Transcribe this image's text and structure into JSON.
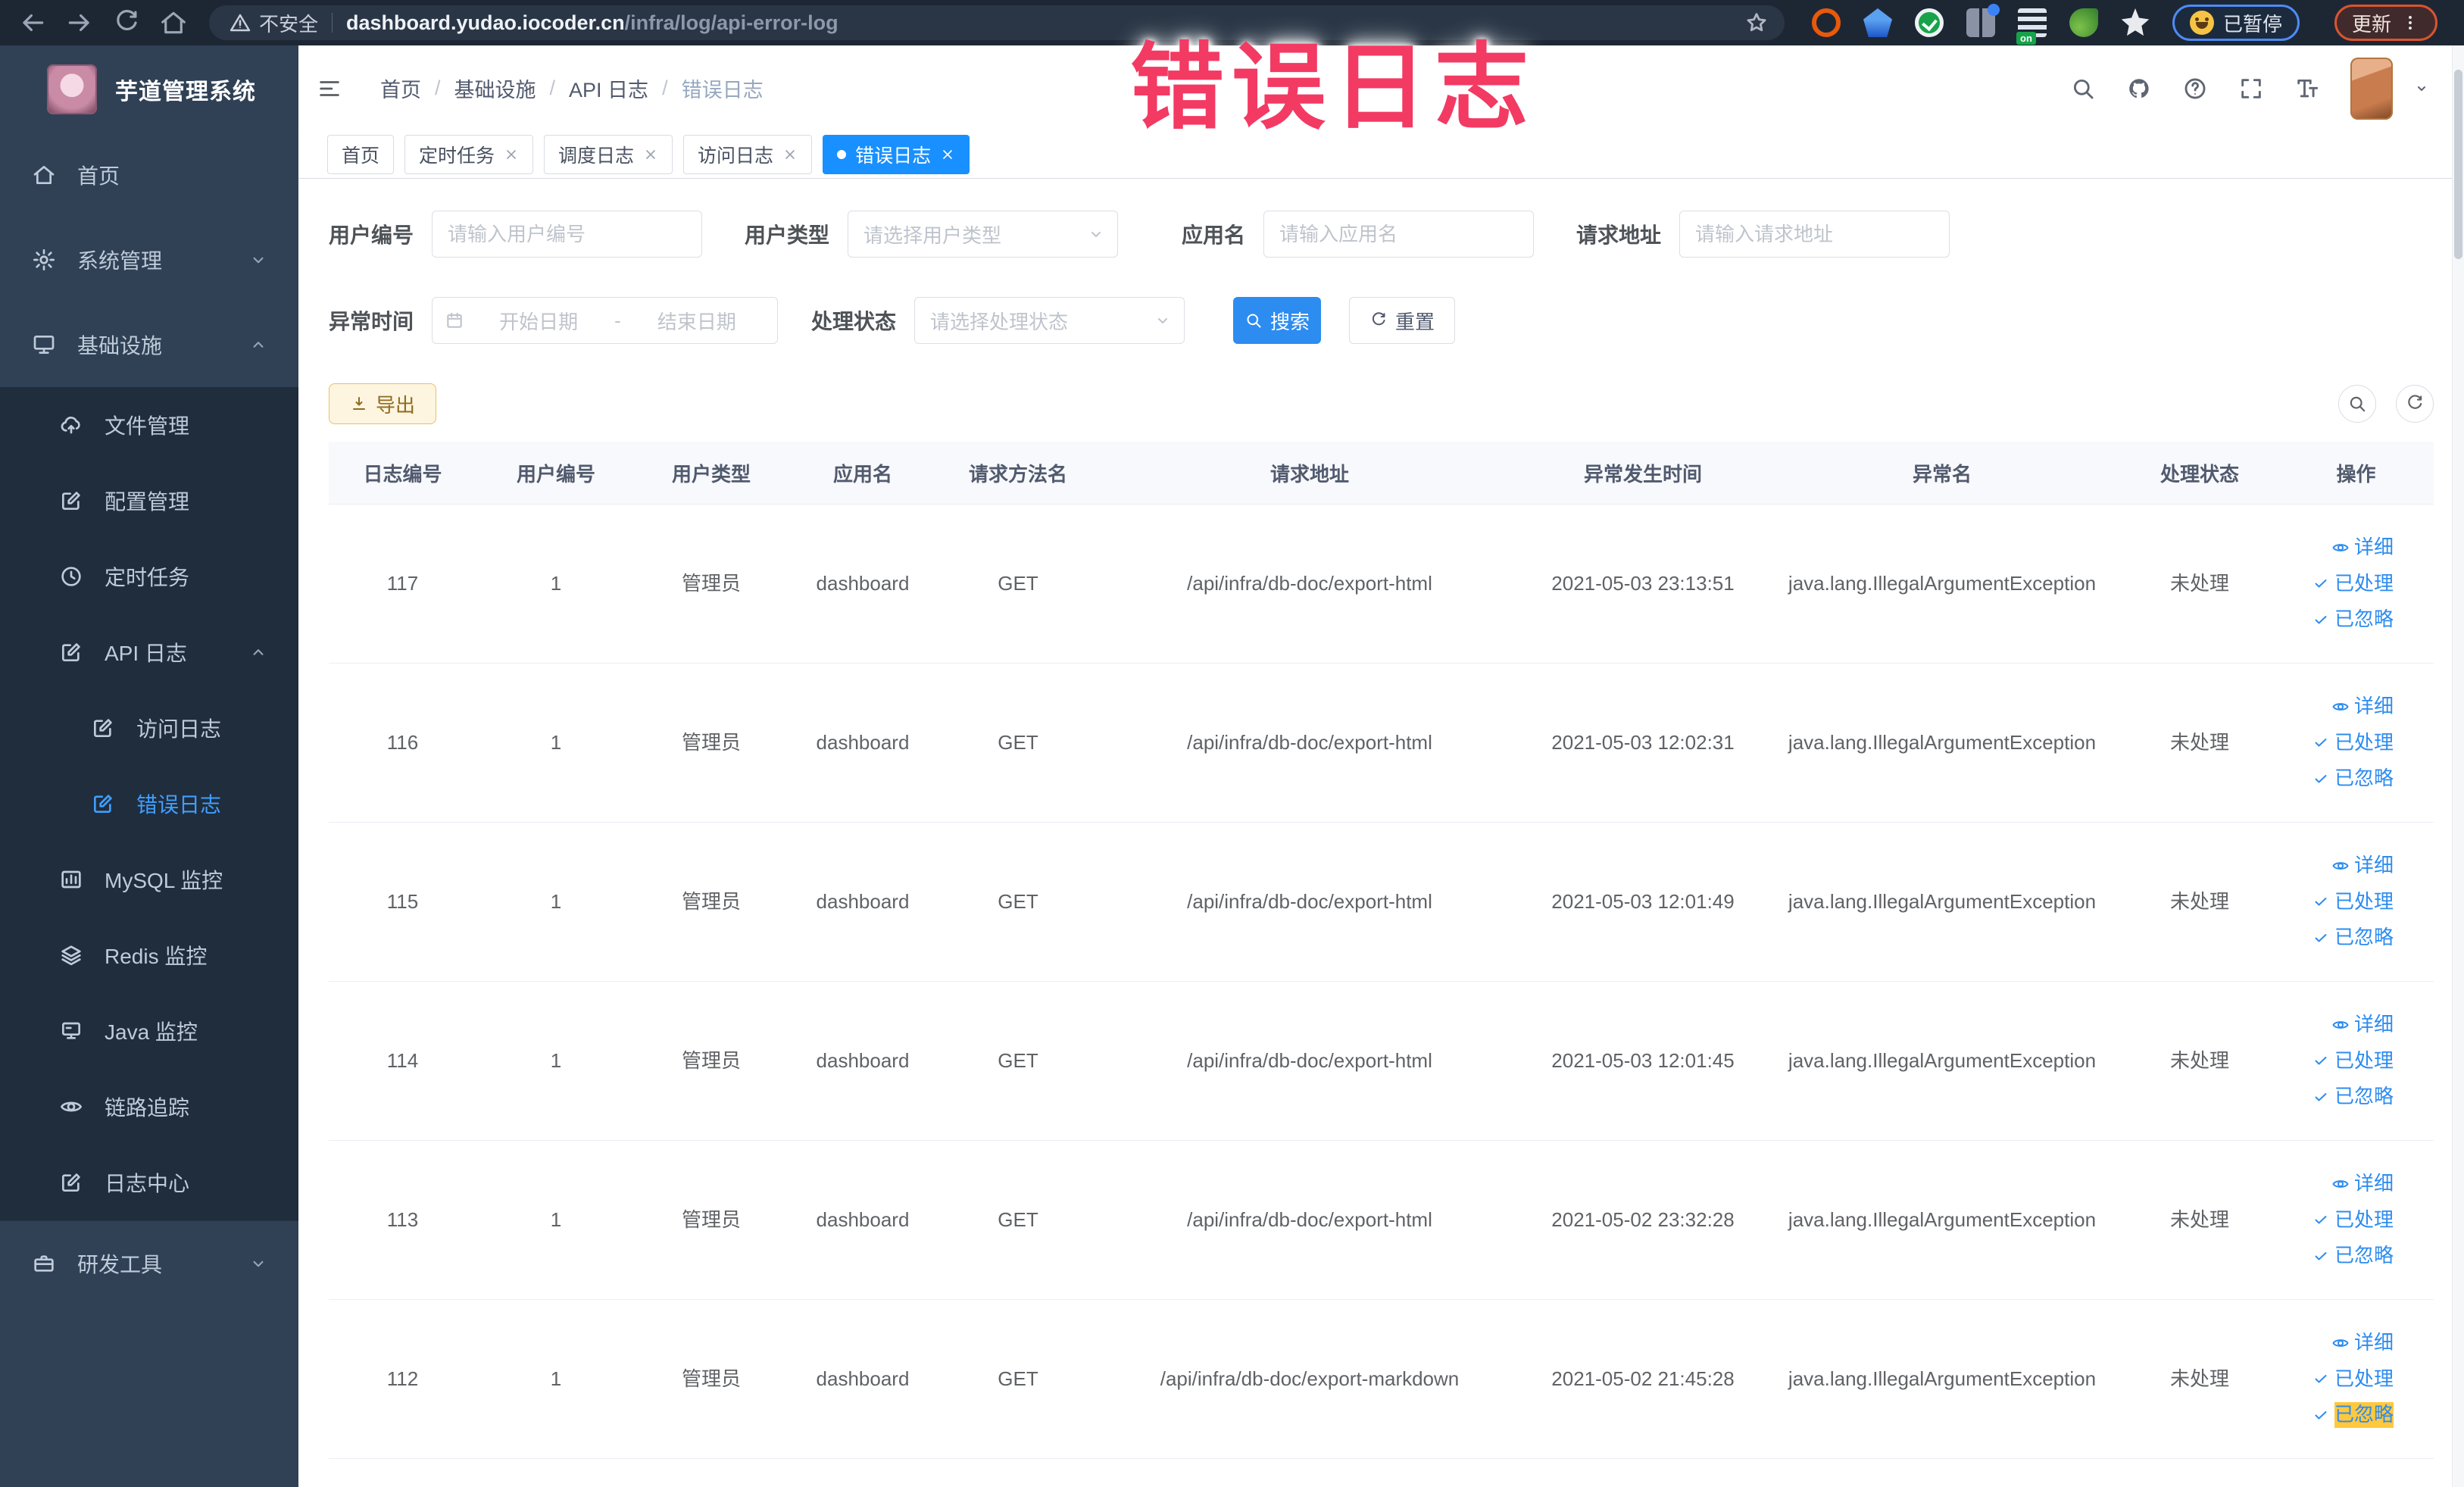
{
  "browser": {
    "security_label": "不安全",
    "url_domain": "dashboard.yudao.iocoder.cn",
    "url_path": "/infra/log/api-error-log",
    "paused_chip": "已暂停",
    "update_chip": "更新"
  },
  "annotation": {
    "text": "错误日志",
    "color": "#f23a63"
  },
  "sidebar": {
    "logo_title": "芋道管理系统",
    "items": [
      {
        "name": "home",
        "label": "首页",
        "icon": "home",
        "level": 1
      },
      {
        "name": "system",
        "label": "系统管理",
        "icon": "gear",
        "level": 1,
        "chevron": "down"
      },
      {
        "name": "infra",
        "label": "基础设施",
        "icon": "monitor",
        "level": 1,
        "chevron": "up"
      },
      {
        "name": "file",
        "label": "文件管理",
        "icon": "cloud",
        "level": 2,
        "group": true
      },
      {
        "name": "config",
        "label": "配置管理",
        "icon": "edit",
        "level": 2,
        "group": true
      },
      {
        "name": "job",
        "label": "定时任务",
        "icon": "clock",
        "level": 2,
        "group": true
      },
      {
        "name": "api-log",
        "label": "API 日志",
        "icon": "edit",
        "level": 2,
        "chevron": "up",
        "group": true
      },
      {
        "name": "access-log",
        "label": "访问日志",
        "icon": "edit",
        "level": 3,
        "group": true
      },
      {
        "name": "error-log",
        "label": "错误日志",
        "icon": "edit",
        "level": 3,
        "group": true,
        "active": true
      },
      {
        "name": "mysql",
        "label": "MySQL 监控",
        "icon": "chart",
        "level": 2,
        "group": true
      },
      {
        "name": "redis",
        "label": "Redis 监控",
        "icon": "layers",
        "level": 2,
        "group": true
      },
      {
        "name": "java",
        "label": "Java 监控",
        "icon": "display",
        "level": 2,
        "group": true
      },
      {
        "name": "trace",
        "label": "链路追踪",
        "icon": "eye",
        "level": 2,
        "group": true
      },
      {
        "name": "log-center",
        "label": "日志中心",
        "icon": "edit",
        "level": 2,
        "group": true
      },
      {
        "name": "dev-tools",
        "label": "研发工具",
        "icon": "tools",
        "level": 1,
        "chevron": "down",
        "divider_before": true
      }
    ]
  },
  "breadcrumb": [
    "首页",
    "基础设施",
    "API 日志",
    "错误日志"
  ],
  "tabs": [
    {
      "label": "首页",
      "closable": false,
      "active": false
    },
    {
      "label": "定时任务",
      "closable": true,
      "active": false
    },
    {
      "label": "调度日志",
      "closable": true,
      "active": false
    },
    {
      "label": "访问日志",
      "closable": true,
      "active": false
    },
    {
      "label": "错误日志",
      "closable": true,
      "active": true
    }
  ],
  "filters": {
    "fields": [
      {
        "name": "user-id",
        "label": "用户编号",
        "placeholder": "请输入用户编号",
        "type": "input"
      },
      {
        "name": "user-type",
        "label": "用户类型",
        "placeholder": "请选择用户类型",
        "type": "select"
      },
      {
        "name": "app-name",
        "label": "应用名",
        "placeholder": "请输入应用名",
        "type": "input"
      },
      {
        "name": "request-url",
        "label": "请求地址",
        "placeholder": "请输入请求地址",
        "type": "input"
      }
    ],
    "exception_time": {
      "label": "异常时间",
      "start_placeholder": "开始日期",
      "separator": "-",
      "end_placeholder": "结束日期"
    },
    "process_status": {
      "label": "处理状态",
      "placeholder": "请选择处理状态"
    },
    "search_label": "搜索",
    "reset_label": "重置"
  },
  "toolbar": {
    "export_label": "导出"
  },
  "table": {
    "columns": [
      "日志编号",
      "用户编号",
      "用户类型",
      "应用名",
      "请求方法名",
      "请求地址",
      "异常发生时间",
      "异常名",
      "处理状态",
      "操作"
    ],
    "action_labels": [
      "详细",
      "已处理",
      "已忽略"
    ],
    "rows": [
      {
        "cells": [
          "117",
          "1",
          "管理员",
          "dashboard",
          "GET",
          "/api/infra/db-doc/export-html",
          "2021-05-03 23:13:51",
          "java.lang.IllegalArgumentException",
          "未处理"
        ]
      },
      {
        "cells": [
          "116",
          "1",
          "管理员",
          "dashboard",
          "GET",
          "/api/infra/db-doc/export-html",
          "2021-05-03 12:02:31",
          "java.lang.IllegalArgumentException",
          "未处理"
        ]
      },
      {
        "cells": [
          "115",
          "1",
          "管理员",
          "dashboard",
          "GET",
          "/api/infra/db-doc/export-html",
          "2021-05-03 12:01:49",
          "java.lang.IllegalArgumentException",
          "未处理"
        ]
      },
      {
        "cells": [
          "114",
          "1",
          "管理员",
          "dashboard",
          "GET",
          "/api/infra/db-doc/export-html",
          "2021-05-03 12:01:45",
          "java.lang.IllegalArgumentException",
          "未处理"
        ]
      },
      {
        "cells": [
          "113",
          "1",
          "管理员",
          "dashboard",
          "GET",
          "/api/infra/db-doc/export-html",
          "2021-05-02 23:32:28",
          "java.lang.IllegalArgumentException",
          "未处理"
        ]
      },
      {
        "cells": [
          "112",
          "1",
          "管理员",
          "dashboard",
          "GET",
          "/api/infra/db-doc/export-markdown",
          "2021-05-02 21:45:28",
          "java.lang.IllegalArgumentException",
          "未处理"
        ],
        "highlight_action": 2
      }
    ]
  }
}
